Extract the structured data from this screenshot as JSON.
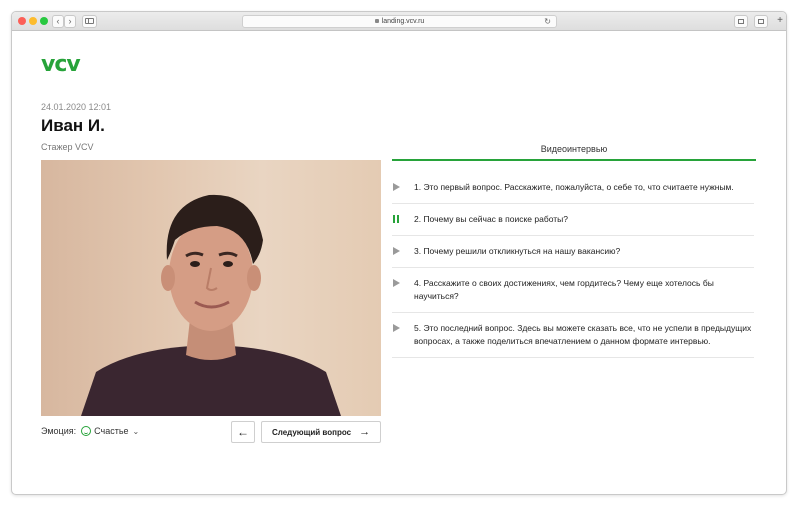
{
  "browser": {
    "url": "landing.vcv.ru",
    "back_glyph": "‹",
    "forward_glyph": "›",
    "reload_glyph": "↻",
    "plus_glyph": "+"
  },
  "logo": "vcv",
  "candidate": {
    "datetime": "24.01.2020 12:01",
    "name": "Иван И.",
    "role": "Стажер VCV"
  },
  "controls": {
    "emotion_label": "Эмоция:",
    "emotion_value": "Счастье",
    "prev_glyph": "←",
    "next_label": "Следующий вопрос",
    "next_glyph": "→"
  },
  "tab_title": "Видеоинтервью",
  "questions": [
    {
      "text": "1. Это первый вопрос. Расскажите, пожалуйста, о себе то, что считаете нужным.",
      "state": "play-icon"
    },
    {
      "text": "2. Почему вы сейчас в поиске работы?",
      "state": "pause-icon"
    },
    {
      "text": "3. Почему решили откликнуться на нашу вакансию?",
      "state": "play-icon"
    },
    {
      "text": "4. Расскажите о своих достижениях, чем гордитесь? Чему еще хотелось бы научиться?",
      "state": "play-icon"
    },
    {
      "text": "5. Это последний вопрос. Здесь вы можете сказать все, что не успели в предыдущих вопросах, а также поделиться впечатлением о данном формате интервью.",
      "state": "play-icon"
    }
  ],
  "colors": {
    "accent": "#27a33a",
    "play_icon": "#9a9a9a"
  }
}
